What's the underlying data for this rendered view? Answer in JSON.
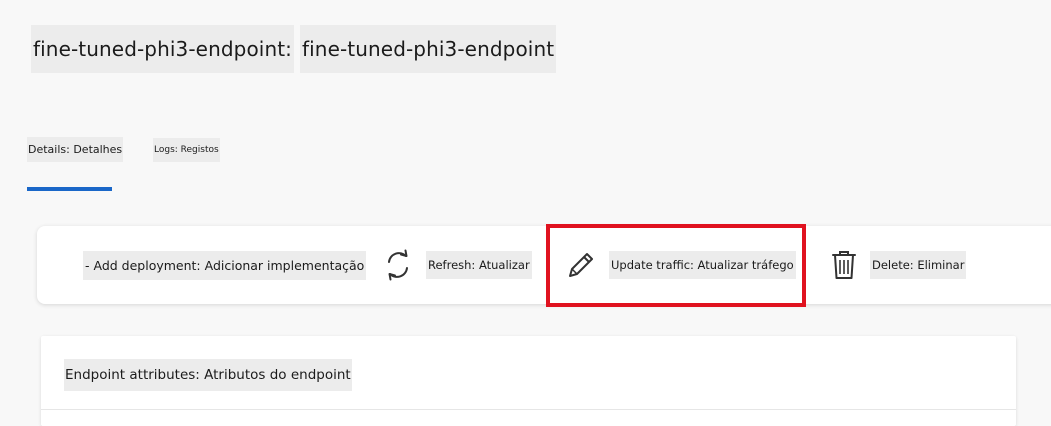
{
  "header": {
    "title_part1": "fine-tuned-phi3-endpoint:",
    "title_part2": "fine-tuned-phi3-endpoint"
  },
  "tabs": [
    {
      "label": "Details: Detalhes",
      "selected": true
    },
    {
      "label": "Logs: Registos",
      "selected": false
    }
  ],
  "toolbar": {
    "add_deployment_label": "- Add deployment: Adicionar implementação",
    "refresh_label": "Refresh: Atualizar",
    "update_traffic_label": "Update traffic: Atualizar tráfego",
    "delete_label": "Delete: Eliminar",
    "icons": {
      "refresh": "refresh-icon",
      "update_traffic": "pencil-icon",
      "delete": "trash-icon"
    }
  },
  "panel": {
    "title": "Endpoint attributes: Atributos do endpoint"
  },
  "colors": {
    "tab_indicator": "#1a67c8",
    "highlight": "#e0121f",
    "background": "#f8f8f8"
  }
}
